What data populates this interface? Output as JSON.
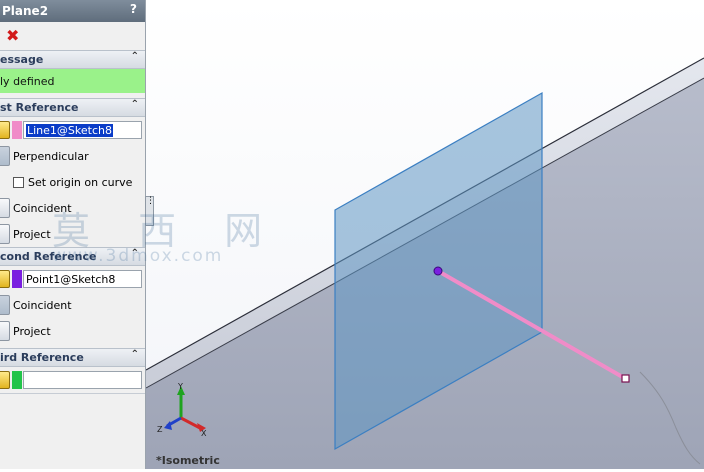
{
  "panel": {
    "title": "Plane2",
    "help": "?",
    "close_glyph": "✖",
    "message_header": "essage",
    "message_text": "ly defined",
    "first_ref_header": "st Reference",
    "first_ref_value": "Line1@Sketch8",
    "perpendicular": "Perpendicular",
    "set_origin": "Set origin on curve",
    "coincident": "Coincident",
    "project": "Project",
    "second_ref_header": "cond Reference",
    "second_ref_value": "Point1@Sketch8",
    "third_ref_header": "ird Reference",
    "third_ref_value": "",
    "collapse_glyph": "⌃"
  },
  "colors": {
    "first_ref_swatch": "#f08cc8",
    "second_ref_swatch": "#7a1fe0",
    "third_ref_swatch": "#22c44a",
    "message_bg": "#9af28a"
  },
  "viewport": {
    "view_name": "*Isometric",
    "watermark_cn": "莫 西 网",
    "watermark_url": "www.3dmox.com",
    "triad_labels": {
      "x": "X",
      "y": "Y",
      "z": "Z"
    }
  }
}
